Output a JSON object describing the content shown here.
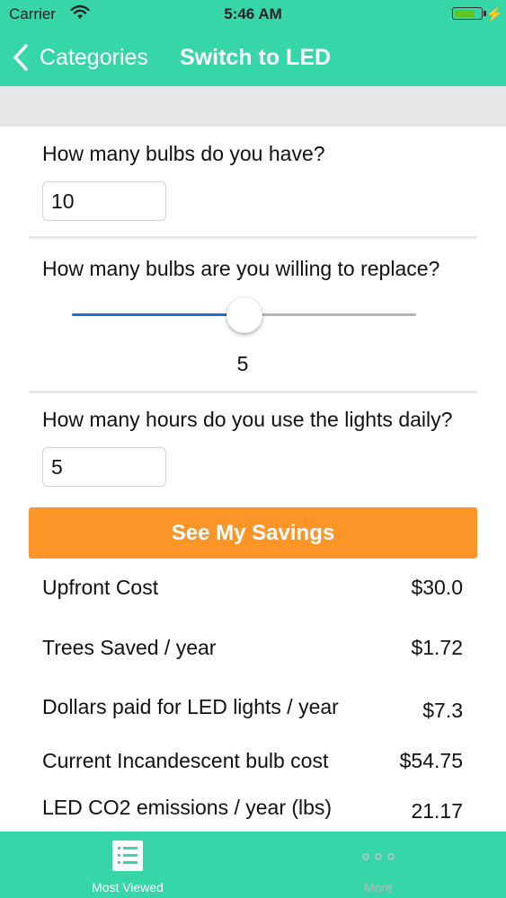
{
  "status_bar": {
    "carrier": "Carrier",
    "time": "5:46 AM",
    "battery_level": 0.85,
    "battery_color": "#5ec41f"
  },
  "nav": {
    "back_label": "Categories",
    "title": "Switch to LED",
    "bar_color": "#36d6a9"
  },
  "form": {
    "q1": {
      "label": "How many bulbs do you have?",
      "value": "10"
    },
    "q2": {
      "label": "How many bulbs are you willing to replace?",
      "slider_fraction": 0.5,
      "value_text": "5"
    },
    "q3": {
      "label": "How many hours do you use the lights daily?",
      "value": "5"
    },
    "cta_label": "See My Savings",
    "cta_color": "#fb9527"
  },
  "results": [
    {
      "label": "Upfront Cost",
      "value": "$30.0"
    },
    {
      "label": "Trees Saved / year",
      "value": "$1.72"
    },
    {
      "label": "Dollars paid for LED lights / year",
      "value": "$7.3"
    },
    {
      "label": "Current Incandescent bulb cost",
      "value": "$54.75"
    },
    {
      "label": "LED CO2 emissions / year (lbs)",
      "value": "21.17"
    }
  ],
  "tabs": [
    {
      "label": "Most Viewed",
      "icon": "list-icon"
    },
    {
      "label": "More",
      "icon": "more-dots-icon"
    }
  ]
}
